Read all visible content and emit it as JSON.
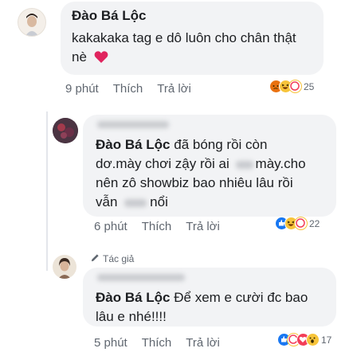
{
  "comments": [
    {
      "author": "Đào Bá Lộc",
      "text": "kakakaka tag e dô luôn cho chân thật",
      "text_line2": "nè",
      "time": "9 phút",
      "like_label": "Thích",
      "reply_label": "Trả lời",
      "reaction_count": "25"
    },
    {
      "mention": "Đào Bá Lộc",
      "text_line1_rest": " đã bóng rồi còn",
      "text_line2": "dơ.mày chơi zậy rồi ai",
      "text_line2_rest": "mày.cho",
      "text_line3": "nên zô showbiz bao nhiêu lâu rồi",
      "text_line4": "vẫn",
      "text_line4_rest": "nổi",
      "time": "6 phút",
      "like_label": "Thích",
      "reply_label": "Trả lời",
      "reaction_count": "22"
    },
    {
      "author_badge": "Tác giả",
      "mention": "Đào Bá Lộc",
      "text_line1_rest": " Để xem e cười đc bao",
      "text_line2": "lâu e nhé!!!!",
      "time": "5 phút",
      "like_label": "Thích",
      "reply_label": "Trả lời",
      "reaction_count": "17"
    }
  ],
  "colors": {
    "bubble": "#f2f3f5",
    "meta": "#606770",
    "heart": "#e0245e",
    "like": "#1877f2"
  }
}
